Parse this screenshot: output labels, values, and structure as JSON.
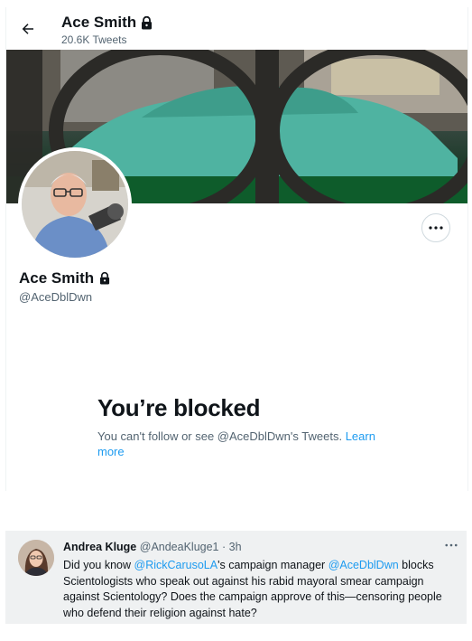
{
  "header": {
    "back_icon": "arrow-left-icon",
    "title": "Ace Smith",
    "tweet_count": "20.6K Tweets"
  },
  "profile": {
    "name": "Ace Smith",
    "handle": "@AceDblDwn",
    "lock_icon": "lock-icon",
    "more_icon": "more-horizontal-icon"
  },
  "blocked": {
    "title": "You’re blocked",
    "message": "You can't follow or see @AceDblDwn's Tweets.",
    "learn_more": "Learn more"
  },
  "tweet": {
    "author_name": "Andrea Kluge",
    "author_handle": "@AndeaKluge1",
    "separator": "·",
    "time": "3h",
    "body_1": "Did you know ",
    "mention_1": "@RickCarusoLA",
    "body_2": "'s campaign manager ",
    "mention_2": "@AceDblDwn",
    "body_3": " blocks Scientologists who speak out against his rabid mayoral smear campaign against Scientology? Does the campaign approve of this—censoring people who defend their religion against hate?",
    "more_icon": "more-horizontal-icon"
  },
  "colors": {
    "accent": "#1d9bf0",
    "text": "#0f1419",
    "muted": "#536471",
    "tweet_bg": "#eff1f2"
  }
}
